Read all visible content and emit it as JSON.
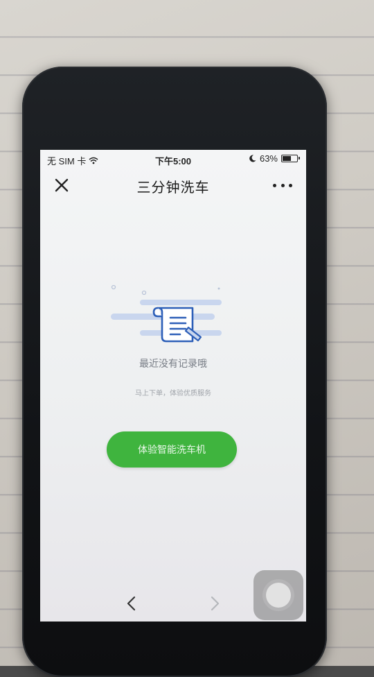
{
  "status_bar": {
    "carrier": "无 SIM 卡",
    "time": "下午5:00",
    "battery_percent": "63%",
    "battery_level": 0.63
  },
  "nav": {
    "title": "三分钟洗车"
  },
  "empty_state": {
    "title": "最近没有记录哦",
    "subtitle": "马上下单，体验优质服务"
  },
  "cta": {
    "label": "体验智能洗车机"
  },
  "colors": {
    "accent_green": "#3fb43e",
    "illustration_blue": "#2d5fb8",
    "illustration_light_blue": "#c9d6ee"
  },
  "icons": {
    "close": "close-icon",
    "more": "more-icon",
    "back": "chevron-left-icon",
    "forward": "chevron-right-icon",
    "empty_illustration": "document-scroll-icon"
  }
}
